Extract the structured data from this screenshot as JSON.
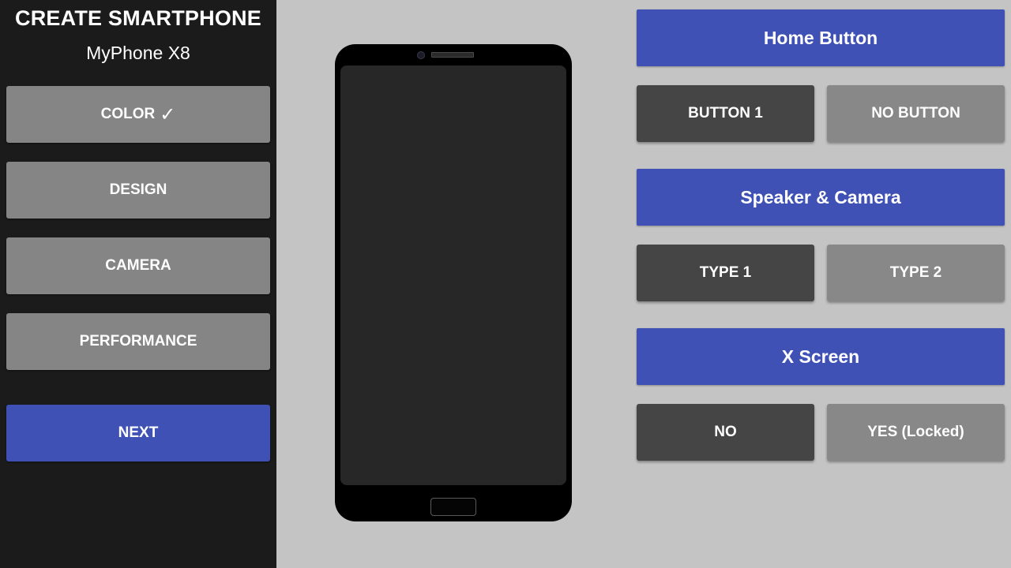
{
  "sidebar": {
    "title": "CREATE SMARTPHONE",
    "phone_name": "MyPhone X8",
    "items": [
      {
        "label": "COLOR",
        "check": "✓"
      },
      {
        "label": "DESIGN"
      },
      {
        "label": "CAMERA"
      },
      {
        "label": "PERFORMANCE"
      }
    ],
    "next_label": "NEXT"
  },
  "options": {
    "home_button": {
      "header": "Home Button",
      "choices": [
        "BUTTON 1",
        "NO BUTTON"
      ]
    },
    "speaker_camera": {
      "header": "Speaker & Camera",
      "choices": [
        "TYPE 1",
        "TYPE 2"
      ]
    },
    "x_screen": {
      "header": "X Screen",
      "choices": [
        "NO",
        "YES (Locked)"
      ]
    }
  },
  "colors": {
    "accent": "#3f51b5",
    "sidebar_bg": "#1b1b1b",
    "content_bg": "#c4c4c4",
    "button_gray": "#858585",
    "selected_dark": "#454545"
  }
}
